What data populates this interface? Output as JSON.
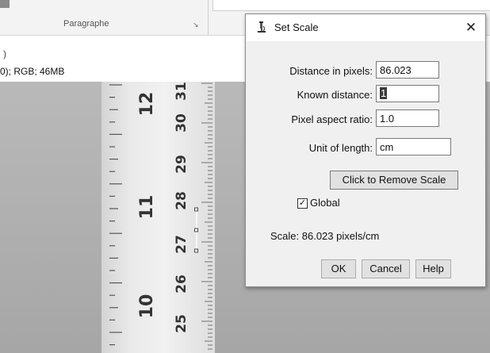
{
  "ribbon": {
    "group_label": "Paragraphe",
    "launcher_glyph": "↘"
  },
  "image_window": {
    "open_paren": ")",
    "info": "0); RGB; 46MB",
    "close_glyph": "✕"
  },
  "ruler": {
    "inch_numbers": [
      "12",
      "11",
      "10"
    ],
    "cm_numbers": [
      "31",
      "30",
      "29",
      "28",
      "27",
      "26",
      "25"
    ]
  },
  "dialog": {
    "title": "Set Scale",
    "close_glyph": "✕",
    "fields": {
      "distance_label": "Distance in pixels:",
      "distance_value": "86.023",
      "known_label": "Known distance:",
      "known_value": "1",
      "aspect_label": "Pixel aspect ratio:",
      "aspect_value": "1.0",
      "unit_label": "Unit of length:",
      "unit_value": "cm"
    },
    "remove_scale_label": "Click to Remove Scale",
    "global_label": "Global",
    "global_checked": true,
    "scale_text": "Scale: 86.023 pixels/cm",
    "buttons": {
      "ok": "OK",
      "cancel": "Cancel",
      "help": "Help"
    }
  },
  "colors": {
    "dialog_bg": "#f0f0f0",
    "photo_bg": "#b0b0b0"
  },
  "icons": {
    "dialog_icon": "microscope-icon"
  }
}
